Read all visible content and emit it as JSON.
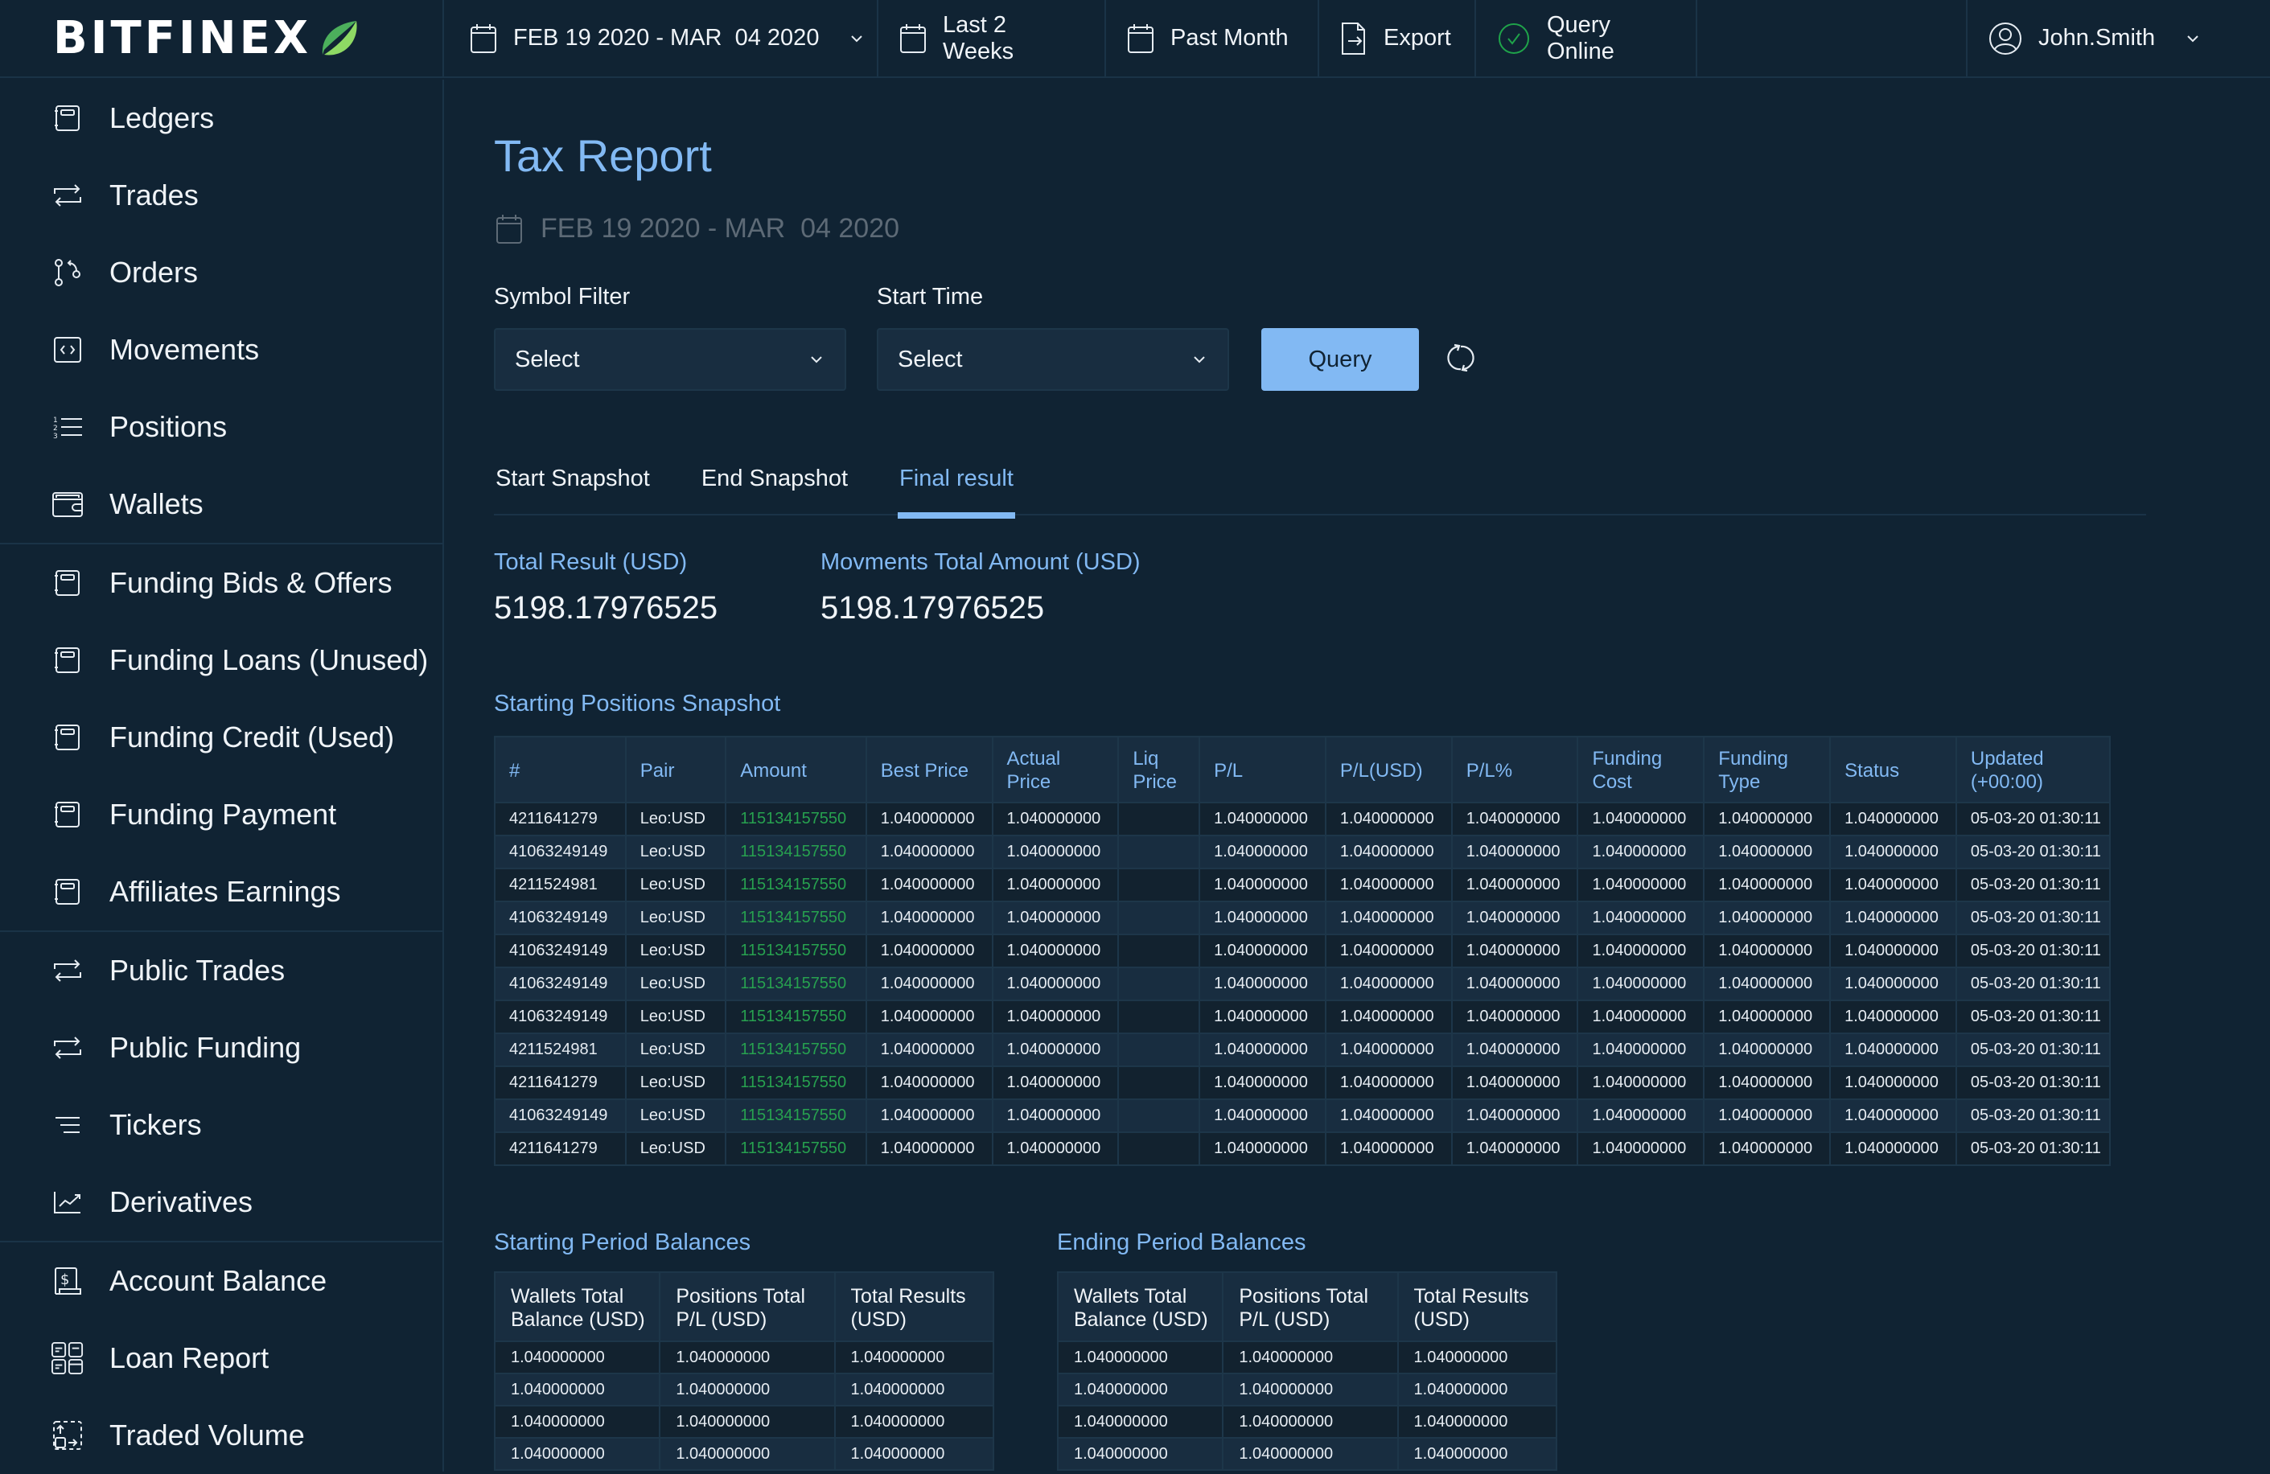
{
  "brand": {
    "name": "BITFINEX",
    "leaf_colors": [
      "#4caf5c",
      "#8ed964"
    ]
  },
  "topbar": {
    "date_range": "FEB 19 2020 - MAR  04 2020",
    "last_2_weeks": "Last 2 Weeks",
    "past_month": "Past Month",
    "export": "Export",
    "query_status": "Query Online",
    "username": "John.Smith"
  },
  "sidebar": {
    "groups": [
      [
        {
          "label": "Ledgers",
          "icon": "ledger-icon"
        },
        {
          "label": "Trades",
          "icon": "swap-icon"
        },
        {
          "label": "Orders",
          "icon": "orders-icon"
        },
        {
          "label": "Movements",
          "icon": "code-box-icon"
        },
        {
          "label": "Positions",
          "icon": "numbered-list-icon"
        },
        {
          "label": "Wallets",
          "icon": "wallet-icon"
        }
      ],
      [
        {
          "label": "Funding Bids & Offers",
          "icon": "ledger-icon"
        },
        {
          "label": "Funding Loans (Unused)",
          "icon": "ledger-icon"
        },
        {
          "label": "Funding Credit (Used)",
          "icon": "ledger-icon"
        },
        {
          "label": "Funding Payment",
          "icon": "ledger-icon"
        },
        {
          "label": "Affiliates Earnings",
          "icon": "ledger-icon"
        }
      ],
      [
        {
          "label": "Public Trades",
          "icon": "swap-icon"
        },
        {
          "label": "Public Funding",
          "icon": "swap-icon"
        },
        {
          "label": "Tickers",
          "icon": "lines-icon"
        },
        {
          "label": "Derivatives",
          "icon": "chart-line-icon"
        }
      ],
      [
        {
          "label": "Account Balance",
          "icon": "dollar-doc-icon"
        },
        {
          "label": "Loan Report",
          "icon": "grid-docs-icon"
        },
        {
          "label": "Traded Volume",
          "icon": "transfer-box-icon"
        }
      ]
    ]
  },
  "main": {
    "title": "Tax Report",
    "date_range": "FEB 19 2020 - MAR  04 2020",
    "symbol_filter": {
      "label": "Symbol Filter",
      "value": "Select"
    },
    "start_time": {
      "label": "Start Time",
      "value": "Select"
    },
    "query_label": "Query",
    "tabs": [
      {
        "label": "Start Snapshot",
        "active": false
      },
      {
        "label": "End Snapshot",
        "active": false
      },
      {
        "label": "Final result",
        "active": true
      }
    ],
    "metrics": [
      {
        "label": "Total Result (USD)",
        "value": "5198.17976525"
      },
      {
        "label": "Movments Total Amount (USD)",
        "value": "5198.17976525"
      }
    ]
  },
  "positions": {
    "title": "Starting Positions Snapshot",
    "columns": [
      "#",
      "Pair",
      "Amount",
      "Best Price",
      "Actual Price",
      "Liq Price",
      "P/L",
      "P/L(USD)",
      "P/L%",
      "Funding Cost",
      "Funding Type",
      "Status",
      "Updated (+00:00)"
    ],
    "rows": [
      [
        "4211641279",
        "Leo:USD",
        "115134157550",
        "1.040000000",
        "1.040000000",
        "",
        "1.040000000",
        "1.040000000",
        "1.040000000",
        "1.040000000",
        "1.040000000",
        "1.040000000",
        "05-03-20 01:30:11"
      ],
      [
        "41063249149",
        "Leo:USD",
        "115134157550",
        "1.040000000",
        "1.040000000",
        "",
        "1.040000000",
        "1.040000000",
        "1.040000000",
        "1.040000000",
        "1.040000000",
        "1.040000000",
        "05-03-20 01:30:11"
      ],
      [
        "4211524981",
        "Leo:USD",
        "115134157550",
        "1.040000000",
        "1.040000000",
        "",
        "1.040000000",
        "1.040000000",
        "1.040000000",
        "1.040000000",
        "1.040000000",
        "1.040000000",
        "05-03-20 01:30:11"
      ],
      [
        "41063249149",
        "Leo:USD",
        "115134157550",
        "1.040000000",
        "1.040000000",
        "",
        "1.040000000",
        "1.040000000",
        "1.040000000",
        "1.040000000",
        "1.040000000",
        "1.040000000",
        "05-03-20 01:30:11"
      ],
      [
        "41063249149",
        "Leo:USD",
        "115134157550",
        "1.040000000",
        "1.040000000",
        "",
        "1.040000000",
        "1.040000000",
        "1.040000000",
        "1.040000000",
        "1.040000000",
        "1.040000000",
        "05-03-20 01:30:11"
      ],
      [
        "41063249149",
        "Leo:USD",
        "115134157550",
        "1.040000000",
        "1.040000000",
        "",
        "1.040000000",
        "1.040000000",
        "1.040000000",
        "1.040000000",
        "1.040000000",
        "1.040000000",
        "05-03-20 01:30:11"
      ],
      [
        "41063249149",
        "Leo:USD",
        "115134157550",
        "1.040000000",
        "1.040000000",
        "",
        "1.040000000",
        "1.040000000",
        "1.040000000",
        "1.040000000",
        "1.040000000",
        "1.040000000",
        "05-03-20 01:30:11"
      ],
      [
        "4211524981",
        "Leo:USD",
        "115134157550",
        "1.040000000",
        "1.040000000",
        "",
        "1.040000000",
        "1.040000000",
        "1.040000000",
        "1.040000000",
        "1.040000000",
        "1.040000000",
        "05-03-20 01:30:11"
      ],
      [
        "4211641279",
        "Leo:USD",
        "115134157550",
        "1.040000000",
        "1.040000000",
        "",
        "1.040000000",
        "1.040000000",
        "1.040000000",
        "1.040000000",
        "1.040000000",
        "1.040000000",
        "05-03-20 01:30:11"
      ],
      [
        "41063249149",
        "Leo:USD",
        "115134157550",
        "1.040000000",
        "1.040000000",
        "",
        "1.040000000",
        "1.040000000",
        "1.040000000",
        "1.040000000",
        "1.040000000",
        "1.040000000",
        "05-03-20 01:30:11"
      ],
      [
        "4211641279",
        "Leo:USD",
        "115134157550",
        "1.040000000",
        "1.040000000",
        "",
        "1.040000000",
        "1.040000000",
        "1.040000000",
        "1.040000000",
        "1.040000000",
        "1.040000000",
        "05-03-20 01:30:11"
      ]
    ]
  },
  "starting_balances": {
    "title": "Starting Period Balances",
    "columns": [
      "Wallets Total Balance (USD)",
      "Positions Total P/L (USD)",
      "Total Results (USD)"
    ],
    "rows": [
      [
        "1.040000000",
        "1.040000000",
        "1.040000000"
      ],
      [
        "1.040000000",
        "1.040000000",
        "1.040000000"
      ],
      [
        "1.040000000",
        "1.040000000",
        "1.040000000"
      ],
      [
        "1.040000000",
        "1.040000000",
        "1.040000000"
      ]
    ]
  },
  "ending_balances": {
    "title": "Ending Period Balances",
    "columns": [
      "Wallets Total Balance (USD)",
      "Positions Total P/L (USD)",
      "Total Results (USD)"
    ],
    "rows": [
      [
        "1.040000000",
        "1.040000000",
        "1.040000000"
      ],
      [
        "1.040000000",
        "1.040000000",
        "1.040000000"
      ],
      [
        "1.040000000",
        "1.040000000",
        "1.040000000"
      ],
      [
        "1.040000000",
        "1.040000000",
        "1.040000000"
      ]
    ]
  },
  "colors": {
    "accent": "#82b9f3",
    "positive": "#27a14f",
    "background": "#102333",
    "status_ok": "#1fa34a"
  }
}
